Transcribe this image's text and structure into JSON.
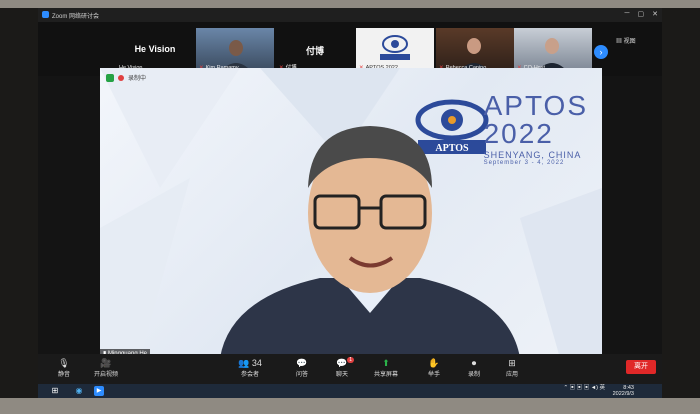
{
  "window": {
    "title": "Zoom 网络研讨会"
  },
  "strip": {
    "tiles": [
      {
        "big": "He Vision",
        "name": "He Vision"
      },
      {
        "name": "Kim Ramamy"
      },
      {
        "big": "付博",
        "name": "付博"
      },
      {
        "name": "APTOS 2022"
      },
      {
        "name": "Rebecca Canino"
      },
      {
        "name": "CO-Host"
      }
    ],
    "next": "›",
    "view_label": "视图"
  },
  "main": {
    "recording_label": "录制中",
    "speaker_name": "Mingguang He",
    "logo": {
      "badge": "APTOS",
      "line1": "APTOS",
      "line2": "2022",
      "line3": "SHENYANG, CHINA",
      "line4": "September 3 - 4, 2022"
    }
  },
  "toolbar": {
    "mute": "静音",
    "video": "开启视频",
    "participants": "参会者",
    "participants_count": "34",
    "qa": "问答",
    "chat": "聊天",
    "chat_badge": "1",
    "share": "共享屏幕",
    "raise_hand": "举手",
    "record": "录制",
    "apps": "应用",
    "leave": "离开"
  },
  "taskbar": {
    "lang": "英",
    "time": "8:43",
    "date": "2022/9/3"
  }
}
